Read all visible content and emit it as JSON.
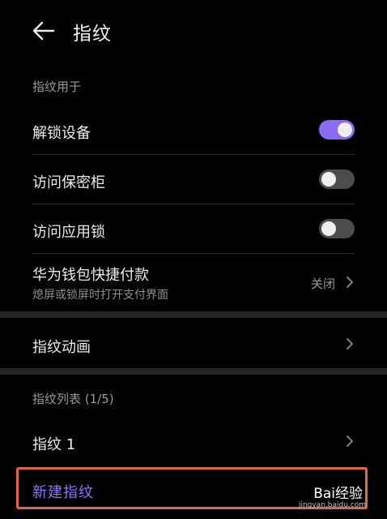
{
  "header": {
    "title": "指纹"
  },
  "section_usage": {
    "label": "指纹用于"
  },
  "rows": {
    "unlock": {
      "label": "解锁设备",
      "toggle_on": true
    },
    "vault": {
      "label": "访问保密柜",
      "toggle_on": false
    },
    "applock": {
      "label": "访问应用锁",
      "toggle_on": false
    },
    "wallet": {
      "label": "华为钱包快捷付款",
      "sublabel": "熄屏或锁屏时打开支付界面",
      "value": "关闭"
    }
  },
  "animation": {
    "label": "指纹动画"
  },
  "section_list": {
    "label": "指纹列表 (1/5)"
  },
  "fingerprints": [
    {
      "label": "指纹 1"
    }
  ],
  "new_fingerprint": {
    "label": "新建指纹"
  },
  "watermark": {
    "brand": "Bai经验",
    "url": "jingyan.baidu.com"
  },
  "colors": {
    "accent": "#8a6cf0",
    "link": "#8d74ff",
    "highlight_border": "#e0644c"
  }
}
